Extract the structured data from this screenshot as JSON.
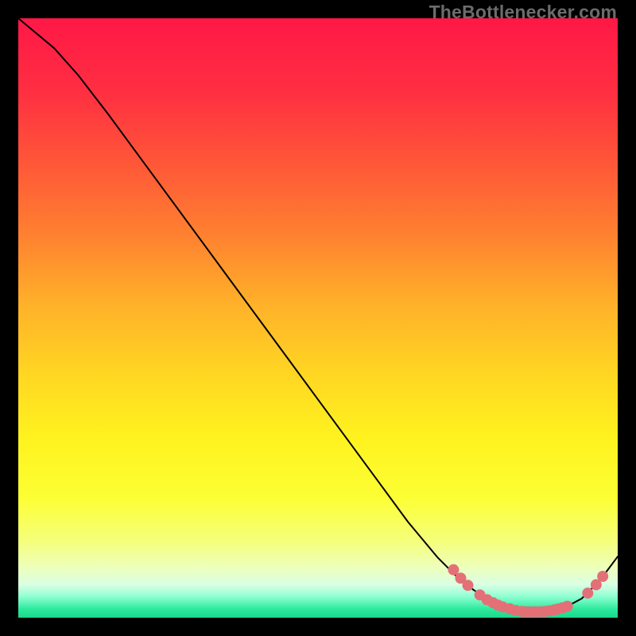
{
  "attribution": "TheBottlenecker.com",
  "gradient": {
    "stops": [
      {
        "offset": 0.0,
        "color": "#ff1846"
      },
      {
        "offset": 0.12,
        "color": "#ff2e42"
      },
      {
        "offset": 0.24,
        "color": "#ff5638"
      },
      {
        "offset": 0.36,
        "color": "#ff8030"
      },
      {
        "offset": 0.48,
        "color": "#ffb229"
      },
      {
        "offset": 0.6,
        "color": "#ffd822"
      },
      {
        "offset": 0.7,
        "color": "#fff21f"
      },
      {
        "offset": 0.8,
        "color": "#fcff34"
      },
      {
        "offset": 0.87,
        "color": "#f5ff78"
      },
      {
        "offset": 0.915,
        "color": "#eeffba"
      },
      {
        "offset": 0.945,
        "color": "#d9ffe4"
      },
      {
        "offset": 0.965,
        "color": "#8effd2"
      },
      {
        "offset": 0.985,
        "color": "#2eea9e"
      },
      {
        "offset": 1.0,
        "color": "#18d889"
      }
    ]
  },
  "chart_data": {
    "type": "line",
    "title": "",
    "xlabel": "",
    "ylabel": "",
    "xlim": [
      0,
      100
    ],
    "ylim": [
      0,
      100
    ],
    "grid": false,
    "series": [
      {
        "name": "curve",
        "x": [
          0,
          6,
          10,
          15,
          20,
          25,
          30,
          35,
          40,
          45,
          50,
          55,
          60,
          65,
          70,
          73,
          76,
          79,
          82,
          85,
          88,
          91,
          94,
          97,
          100
        ],
        "y": [
          100,
          95,
          90.5,
          84,
          77.2,
          70.4,
          63.6,
          56.8,
          50,
          43.2,
          36.4,
          29.6,
          22.8,
          16,
          10,
          7,
          4.6,
          2.8,
          1.6,
          1.0,
          1.0,
          1.6,
          3.2,
          6.2,
          10.2
        ],
        "color": "#000000"
      }
    ],
    "markers": {
      "name": "highlight-points",
      "color": "#e37077",
      "points": [
        {
          "x": 72.6,
          "y": 8.0
        },
        {
          "x": 73.8,
          "y": 6.6
        },
        {
          "x": 75.0,
          "y": 5.4
        },
        {
          "x": 77.0,
          "y": 3.8
        },
        {
          "x": 78.2,
          "y": 3.0
        },
        {
          "x": 79.2,
          "y": 2.5
        },
        {
          "x": 80.0,
          "y": 2.1
        },
        {
          "x": 80.8,
          "y": 1.8
        },
        {
          "x": 82.0,
          "y": 1.5
        },
        {
          "x": 83.0,
          "y": 1.2
        },
        {
          "x": 84.0,
          "y": 1.05
        },
        {
          "x": 84.7,
          "y": 1.0
        },
        {
          "x": 85.4,
          "y": 1.0
        },
        {
          "x": 86.2,
          "y": 1.0
        },
        {
          "x": 87.0,
          "y": 1.0
        },
        {
          "x": 87.8,
          "y": 1.05
        },
        {
          "x": 88.6,
          "y": 1.15
        },
        {
          "x": 89.4,
          "y": 1.3
        },
        {
          "x": 90.0,
          "y": 1.45
        },
        {
          "x": 90.8,
          "y": 1.65
        },
        {
          "x": 91.6,
          "y": 1.9
        },
        {
          "x": 95.0,
          "y": 4.1
        },
        {
          "x": 96.4,
          "y": 5.5
        },
        {
          "x": 97.5,
          "y": 6.9
        }
      ]
    }
  }
}
